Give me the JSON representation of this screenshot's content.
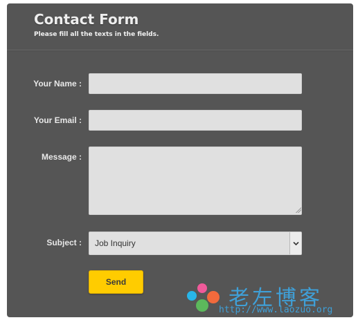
{
  "header": {
    "title": "Contact Form",
    "subtitle": "Please fill all the texts in the fields."
  },
  "form": {
    "name_label": "Your Name :",
    "name_value": "",
    "email_label": "Your Email :",
    "email_value": "",
    "message_label": "Message :",
    "message_value": "",
    "subject_label": "Subject :",
    "subject_selected": "Job Inquiry",
    "send_label": "Send"
  },
  "watermark": {
    "site_name": "老左博客",
    "url": "http://www.laozuo.org"
  },
  "colors": {
    "panel": "#555555",
    "field": "#e0e0e0",
    "button": "#ffcc00",
    "watermark": "#3fa0d8"
  },
  "icons": {
    "select_arrow": "chevron-down-icon",
    "watermark_logo": "colored-dots-logo"
  }
}
